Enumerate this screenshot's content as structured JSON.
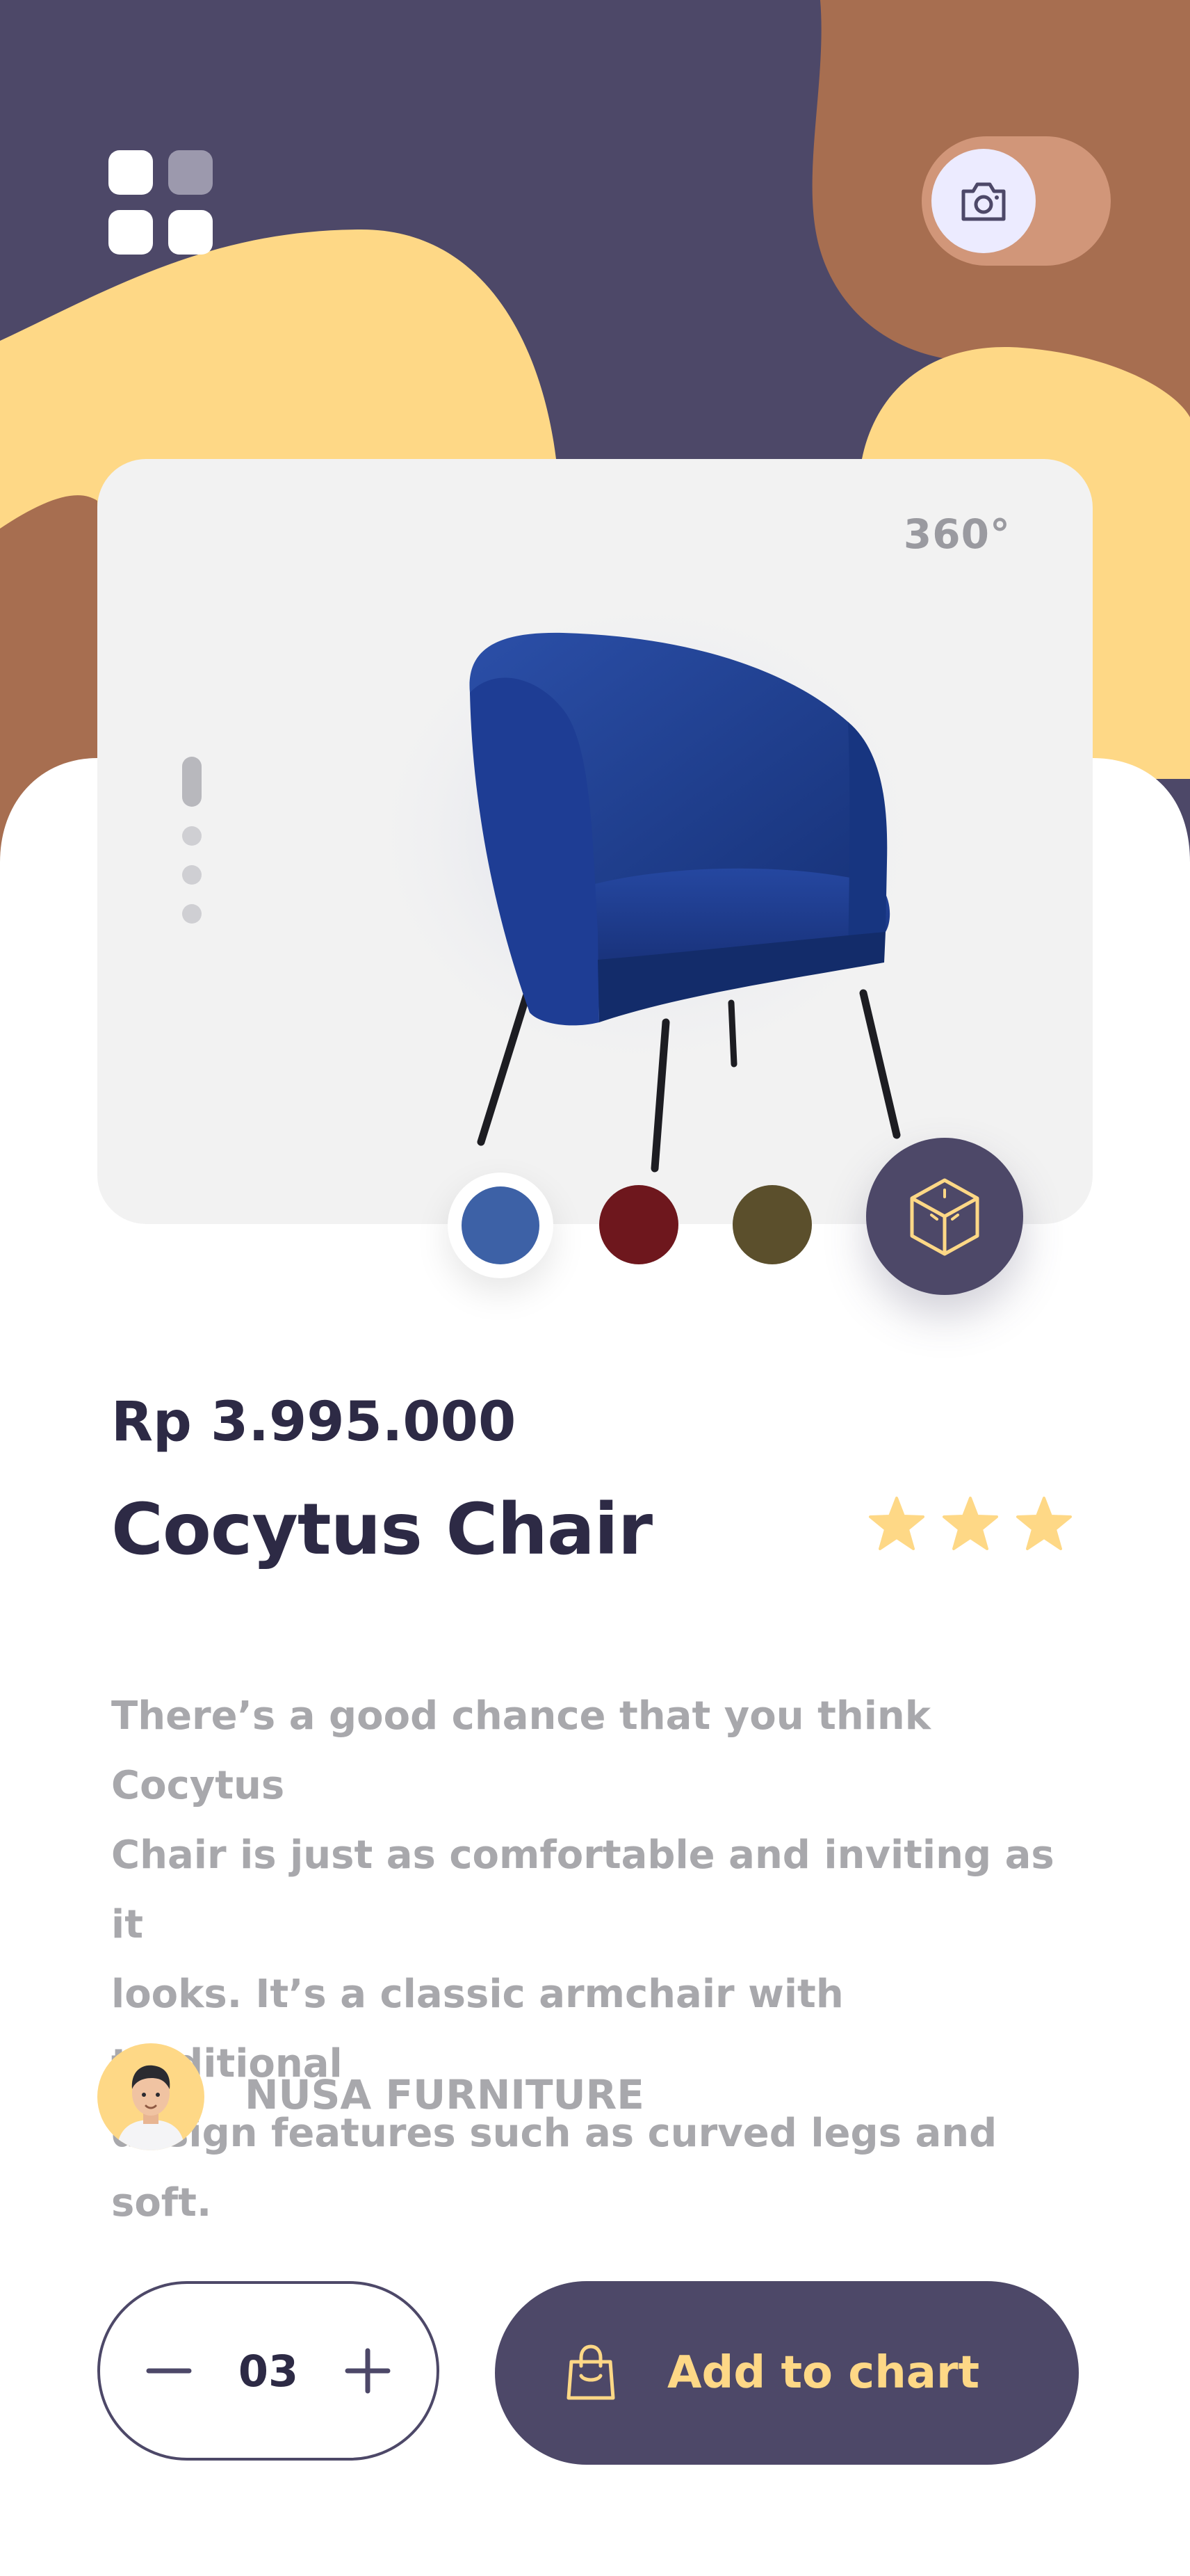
{
  "colors": {
    "primary": "#4d4868",
    "accent_yellow": "#fed886",
    "accent_brown": "#a76e50",
    "card_bg": "#f2f2f2",
    "text_dark": "#2d2a45",
    "text_muted": "#a8a8ac"
  },
  "header": {
    "menu_icon": "grid-menu-icon",
    "camera_icon": "camera-icon"
  },
  "product_view": {
    "rotation_label": "360°",
    "image_pager": {
      "count": 4,
      "active_index": 0
    },
    "colors": [
      {
        "name": "blue",
        "hex": "#3d61a6",
        "selected": true
      },
      {
        "name": "red",
        "hex": "#6e171d",
        "selected": false
      },
      {
        "name": "olive",
        "hex": "#5b4f2c",
        "selected": false
      }
    ],
    "ar_icon": "3d-box-icon"
  },
  "product": {
    "price": "Rp 3.995.000",
    "name": "Cocytus Chair",
    "rating_stars": 3,
    "description_lines": [
      "There’s a good chance that you think Cocytus",
      "Chair is just as comfortable and inviting as it",
      "looks. It’s a classic armchair with traditional",
      "design features such as curved legs and soft."
    ]
  },
  "seller": {
    "name": "NUSA FURNITURE"
  },
  "actions": {
    "quantity": "03",
    "add_to_cart_label": "Add to chart",
    "bag_icon": "shopping-bag-icon"
  }
}
